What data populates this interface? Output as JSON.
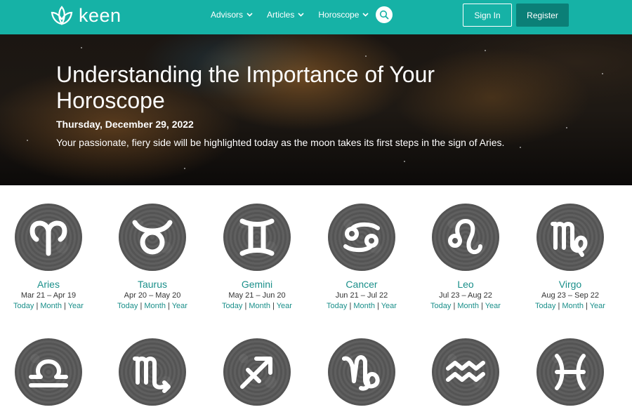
{
  "header": {
    "logo_text": "keen",
    "nav": [
      {
        "label": "Advisors"
      },
      {
        "label": "Articles"
      },
      {
        "label": "Horoscope"
      }
    ],
    "signin_label": "Sign In",
    "register_label": "Register",
    "brand_color": "#16b2a6"
  },
  "hero": {
    "title": "Understanding the Importance of Your Horoscope",
    "date": "Thursday, December 29, 2022",
    "text": "Your passionate, fiery side will be highlighted today as the moon takes its first steps in the sign of Aries."
  },
  "signs": [
    {
      "name": "Aries",
      "dates": "Mar 21 – Apr 19",
      "icon": "aries-icon"
    },
    {
      "name": "Taurus",
      "dates": "Apr 20 – May 20",
      "icon": "taurus-icon"
    },
    {
      "name": "Gemini",
      "dates": "May 21 – Jun 20",
      "icon": "gemini-icon"
    },
    {
      "name": "Cancer",
      "dates": "Jun 21 – Jul 22",
      "icon": "cancer-icon"
    },
    {
      "name": "Leo",
      "dates": "Jul 23 – Aug 22",
      "icon": "leo-icon"
    },
    {
      "name": "Virgo",
      "dates": "Aug 23 – Sep 22",
      "icon": "virgo-icon"
    },
    {
      "icon": "libra-icon"
    },
    {
      "icon": "scorpio-icon"
    },
    {
      "icon": "sagittarius-icon"
    },
    {
      "icon": "capricorn-icon"
    },
    {
      "icon": "aquarius-icon"
    },
    {
      "icon": "pisces-icon"
    }
  ],
  "period_links": {
    "today": "Today",
    "month": "Month",
    "year": "Year"
  }
}
